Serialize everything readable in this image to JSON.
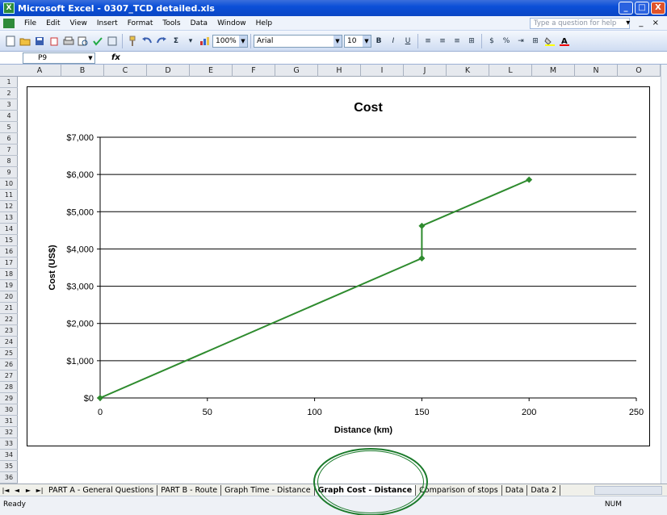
{
  "window": {
    "title": "Microsoft Excel - 0307_TCD detailed.xls",
    "buttons": [
      "_",
      "□",
      "X"
    ]
  },
  "menubar": {
    "items": [
      "File",
      "Edit",
      "View",
      "Insert",
      "Format",
      "Tools",
      "Data",
      "Window",
      "Help"
    ],
    "help_placeholder": "Type a question for help",
    "right_controls": "▾ _ ×"
  },
  "toolbar": {
    "zoom": "100%",
    "font_name": "Arial",
    "font_size": "10",
    "bold": "B",
    "italic": "I",
    "underline": "U",
    "currency": "$",
    "percent": "%"
  },
  "formula_bar": {
    "name_box": "P9",
    "fx": "fx"
  },
  "columns": [
    "A",
    "B",
    "C",
    "D",
    "E",
    "F",
    "G",
    "H",
    "I",
    "J",
    "K",
    "L",
    "M",
    "N",
    "O"
  ],
  "rows": [
    "1",
    "2",
    "3",
    "4",
    "5",
    "6",
    "7",
    "8",
    "9",
    "10",
    "11",
    "12",
    "13",
    "14",
    "15",
    "16",
    "17",
    "18",
    "19",
    "20",
    "21",
    "22",
    "23",
    "24",
    "25",
    "26",
    "27",
    "28",
    "29",
    "30",
    "31",
    "32",
    "33",
    "34",
    "35",
    "36"
  ],
  "chart_data": {
    "type": "line",
    "title": "Cost",
    "xlabel": "Distance (km)",
    "ylabel": "Cost (US$)",
    "xlim": [
      0,
      250
    ],
    "ylim": [
      0,
      7000
    ],
    "xticks": [
      "0",
      "50",
      "100",
      "150",
      "200",
      "250"
    ],
    "yticks": [
      "$0",
      "$1,000",
      "$2,000",
      "$3,000",
      "$4,000",
      "$5,000",
      "$6,000",
      "$7,000"
    ],
    "grid": "horizontal major gridlines",
    "color": "#2e8b2e",
    "series": [
      {
        "x": [
          0,
          150,
          150,
          200
        ],
        "y": [
          0,
          3750,
          4620,
          5860
        ]
      }
    ]
  },
  "sheet_tabs": {
    "nav": [
      "|◄",
      "◄",
      "►",
      "►|"
    ],
    "tabs": [
      "PART A - General Questions",
      "PART B - Route",
      "Graph Time - Distance",
      "Graph Cost - Distance",
      "Comparison of stops",
      "Data",
      "Data 2"
    ],
    "active": "Graph Cost - Distance"
  },
  "status": {
    "text": "Ready",
    "num": "NUM"
  },
  "annotation": {
    "ellipse_color": "#1a7a2a"
  }
}
